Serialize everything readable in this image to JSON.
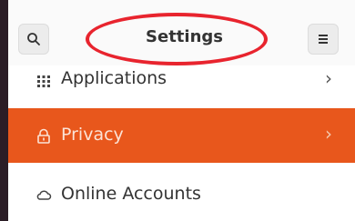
{
  "header": {
    "title": "Settings",
    "search_icon": "search-icon",
    "menu_icon": "hamburger-menu-icon"
  },
  "sidebar": {
    "items": [
      {
        "label": "Applications",
        "icon": "grid-icon",
        "has_chevron": true,
        "selected": false
      },
      {
        "label": "Privacy",
        "icon": "lock-icon",
        "has_chevron": true,
        "selected": true
      },
      {
        "label": "Online Accounts",
        "icon": "cloud-icon",
        "has_chevron": false,
        "selected": false
      }
    ]
  },
  "annotation": {
    "color": "#e8242e",
    "shape": "oval"
  },
  "colors": {
    "accent": "#e8571c",
    "window_border": "#2b1d26"
  }
}
